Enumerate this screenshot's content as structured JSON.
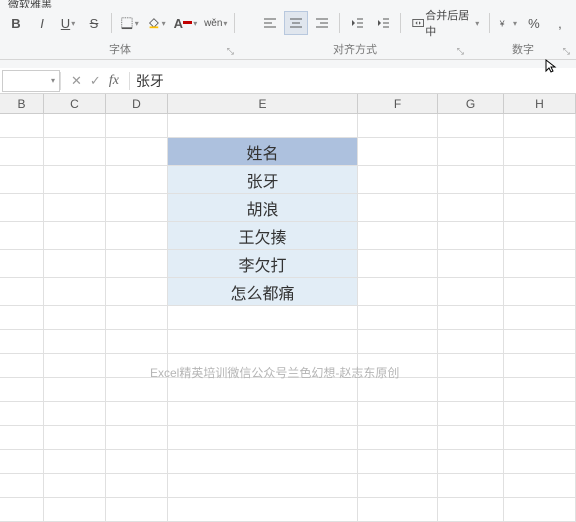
{
  "ribbon_top": {
    "left_frag": "微软雅黑"
  },
  "toolbar": {
    "bold": "B",
    "italic": "I",
    "underline": "U",
    "wen": "wěn",
    "merge_label": "合并后居中",
    "percent": "%",
    "comma": ","
  },
  "groups": {
    "font": "字体",
    "align": "对齐方式",
    "number": "数字"
  },
  "formula_bar": {
    "cancel": "✕",
    "confirm": "✓",
    "fx": "fx",
    "value": "张牙"
  },
  "columns": {
    "B": "B",
    "C": "C",
    "D": "D",
    "E": "E",
    "F": "F",
    "G": "G",
    "H": "H"
  },
  "table": {
    "header": "姓名",
    "rows": [
      "张牙",
      "胡浪",
      "王欠揍",
      "李欠打",
      "怎么都痛"
    ]
  },
  "watermark": "Excel精英培训微信公众号兰色幻想-赵志东原创"
}
